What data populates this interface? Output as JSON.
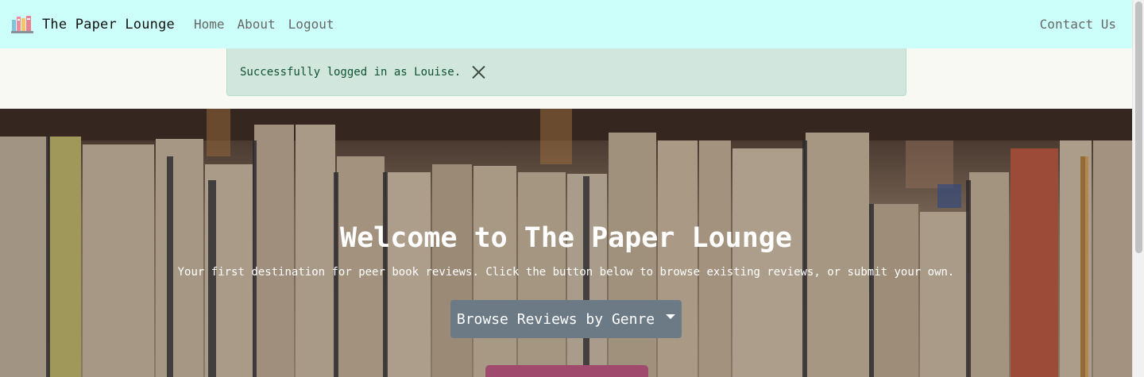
{
  "navbar": {
    "brand": "The Paper Lounge",
    "brand_icon": "books-icon",
    "links": [
      "Home",
      "About",
      "Logout"
    ],
    "contact": "Contact Us",
    "background": "#ccfff9"
  },
  "alert": {
    "message": "Successfully logged in as Louise.",
    "close_icon": "close-icon",
    "background": "#d1e7dd"
  },
  "hero": {
    "title": "Welcome to The Paper Lounge",
    "subtitle": "Your first destination for peer book reviews. Click the button below to browse existing reviews, or submit your own.",
    "browse_button": "Browse Reviews by Genre",
    "browse_button_color": "#6c7a86",
    "secondary_button_color": "#a04a6e"
  }
}
